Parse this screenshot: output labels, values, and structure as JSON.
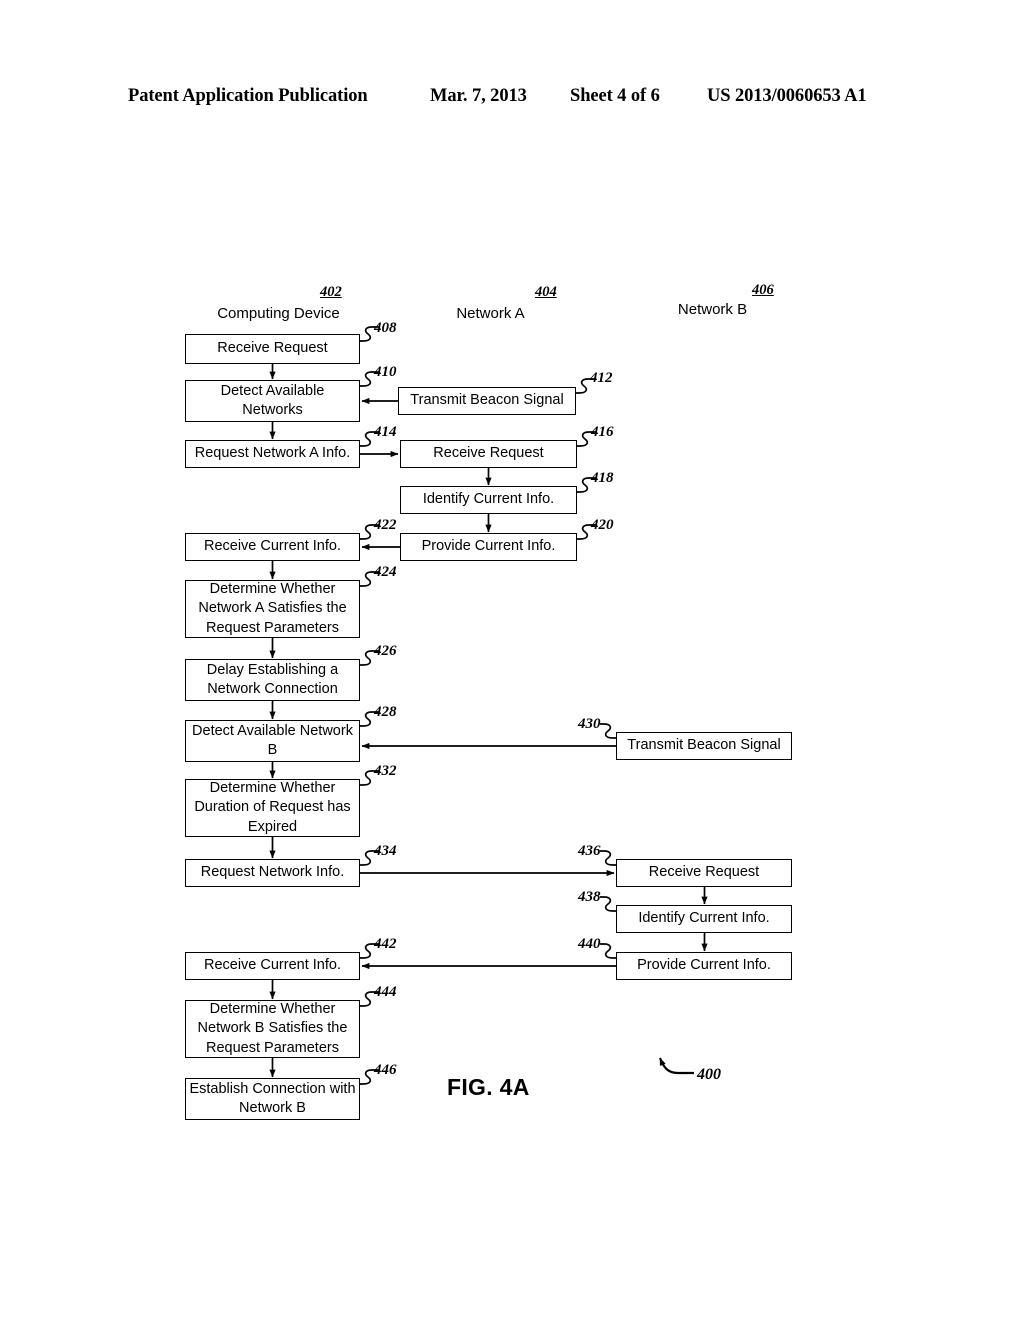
{
  "header": {
    "publication": "Patent Application Publication",
    "date": "Mar. 7, 2013",
    "sheet": "Sheet 4 of 6",
    "number": "US 2013/0060653 A1"
  },
  "figure": {
    "caption": "FIG. 4A",
    "reference": "400"
  },
  "columns": [
    {
      "id": "computing-device",
      "title": "Computing Device",
      "ref": "402"
    },
    {
      "id": "network-a",
      "title": "Network A",
      "ref": "404"
    },
    {
      "id": "network-b",
      "title": "Network B",
      "ref": "406"
    }
  ],
  "nodes": [
    {
      "id": "n408",
      "ref": "408",
      "column": "computing-device",
      "label": "Receive Request"
    },
    {
      "id": "n410",
      "ref": "410",
      "column": "computing-device",
      "label": "Detect Available Networks"
    },
    {
      "id": "n412",
      "ref": "412",
      "column": "network-a",
      "label": "Transmit Beacon Signal"
    },
    {
      "id": "n414",
      "ref": "414",
      "column": "computing-device",
      "label": "Request Network A Info."
    },
    {
      "id": "n416",
      "ref": "416",
      "column": "network-a",
      "label": "Receive Request"
    },
    {
      "id": "n418",
      "ref": "418",
      "column": "network-a",
      "label": "Identify Current Info."
    },
    {
      "id": "n420",
      "ref": "420",
      "column": "network-a",
      "label": "Provide Current Info."
    },
    {
      "id": "n422",
      "ref": "422",
      "column": "computing-device",
      "label": "Receive Current Info."
    },
    {
      "id": "n424",
      "ref": "424",
      "column": "computing-device",
      "label": "Determine Whether Network A Satisfies the Request Parameters"
    },
    {
      "id": "n426",
      "ref": "426",
      "column": "computing-device",
      "label": "Delay Establishing a Network Connection"
    },
    {
      "id": "n428",
      "ref": "428",
      "column": "computing-device",
      "label": "Detect Available Network B"
    },
    {
      "id": "n430",
      "ref": "430",
      "column": "network-b",
      "label": "Transmit Beacon Signal"
    },
    {
      "id": "n432",
      "ref": "432",
      "column": "computing-device",
      "label": "Determine Whether Duration of Request has Expired"
    },
    {
      "id": "n434",
      "ref": "434",
      "column": "computing-device",
      "label": "Request Network Info."
    },
    {
      "id": "n436",
      "ref": "436",
      "column": "network-b",
      "label": "Receive Request"
    },
    {
      "id": "n438",
      "ref": "438",
      "column": "network-b",
      "label": "Identify Current Info."
    },
    {
      "id": "n440",
      "ref": "440",
      "column": "network-b",
      "label": "Provide Current Info."
    },
    {
      "id": "n442",
      "ref": "442",
      "column": "computing-device",
      "label": "Receive Current Info."
    },
    {
      "id": "n444",
      "ref": "444",
      "column": "computing-device",
      "label": "Determine Whether Network B Satisfies the Request Parameters"
    },
    {
      "id": "n446",
      "ref": "446",
      "column": "computing-device",
      "label": "Establish Connection with Network B"
    }
  ],
  "edges": [
    {
      "from": "n408",
      "to": "n410",
      "direction": "down"
    },
    {
      "from": "n412",
      "to": "n410",
      "direction": "left"
    },
    {
      "from": "n410",
      "to": "n414",
      "direction": "down"
    },
    {
      "from": "n414",
      "to": "n416",
      "direction": "right"
    },
    {
      "from": "n416",
      "to": "n418",
      "direction": "down"
    },
    {
      "from": "n418",
      "to": "n420",
      "direction": "down"
    },
    {
      "from": "n420",
      "to": "n422",
      "direction": "left"
    },
    {
      "from": "n422",
      "to": "n424",
      "direction": "down"
    },
    {
      "from": "n424",
      "to": "n426",
      "direction": "down"
    },
    {
      "from": "n426",
      "to": "n428",
      "direction": "down"
    },
    {
      "from": "n430",
      "to": "n428",
      "direction": "left"
    },
    {
      "from": "n428",
      "to": "n432",
      "direction": "down"
    },
    {
      "from": "n432",
      "to": "n434",
      "direction": "down"
    },
    {
      "from": "n434",
      "to": "n436",
      "direction": "right"
    },
    {
      "from": "n436",
      "to": "n438",
      "direction": "down"
    },
    {
      "from": "n438",
      "to": "n440",
      "direction": "down"
    },
    {
      "from": "n440",
      "to": "n442",
      "direction": "left"
    },
    {
      "from": "n442",
      "to": "n444",
      "direction": "down"
    },
    {
      "from": "n444",
      "to": "n446",
      "direction": "down"
    }
  ]
}
